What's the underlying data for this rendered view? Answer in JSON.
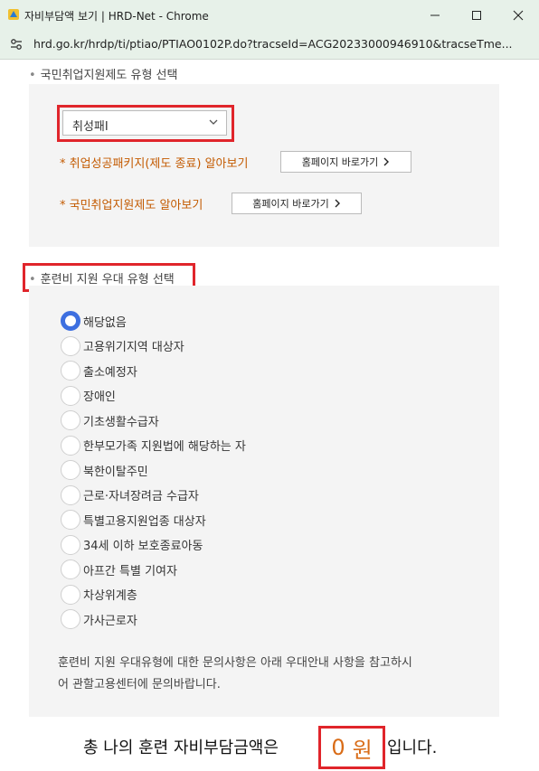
{
  "window": {
    "title": "자비부담액 보기 | HRD-Net - Chrome",
    "url": "hrd.go.kr/hrdp/ti/ptiao/PTIAO0102P.do?tracseId=ACG20233000946910&tracseTme..."
  },
  "section1": {
    "title": "국민취업지원제도 유형 선택",
    "select_value": "취성패Ⅰ",
    "links": [
      {
        "label": "* 취업성공패키지(제도 종료) 알아보기",
        "button": "홈페이지 바로가기"
      },
      {
        "label": "* 국민취업지원제도 알아보기",
        "button": "홈페이지 바로가기"
      }
    ]
  },
  "section2": {
    "title": "훈련비 지원 우대 유형 선택",
    "options": [
      {
        "label": "해당없음",
        "checked": true
      },
      {
        "label": "고용위기지역 대상자",
        "checked": false
      },
      {
        "label": "출소예정자",
        "checked": false
      },
      {
        "label": "장애인",
        "checked": false
      },
      {
        "label": "기초생활수급자",
        "checked": false
      },
      {
        "label": "한부모가족 지원법에 해당하는 자",
        "checked": false
      },
      {
        "label": "북한이탈주민",
        "checked": false
      },
      {
        "label": "근로·자녀장려금 수급자",
        "checked": false
      },
      {
        "label": "특별고용지원업종 대상자",
        "checked": false
      },
      {
        "label": "34세 이하 보호종료아동",
        "checked": false
      },
      {
        "label": "아프간 특별 기여자",
        "checked": false
      },
      {
        "label": "차상위계층",
        "checked": false
      },
      {
        "label": "가사근로자",
        "checked": false
      }
    ],
    "notice_line1": "훈련비 지원 우대유형에 대한 문의사항은 아래 우대안내 사항을 참고하시",
    "notice_line2": "어 관할고용센터에 문의바랍니다."
  },
  "total": {
    "prefix": "총 나의 훈련 자비부담금액은",
    "amount": "0",
    "unit": "원",
    "suffix": "입니다."
  },
  "colors": {
    "accent_red": "#e0252b",
    "link_orange": "#c35a00",
    "amount_orange": "#d96c17",
    "radio_blue": "#3d6fe0"
  }
}
